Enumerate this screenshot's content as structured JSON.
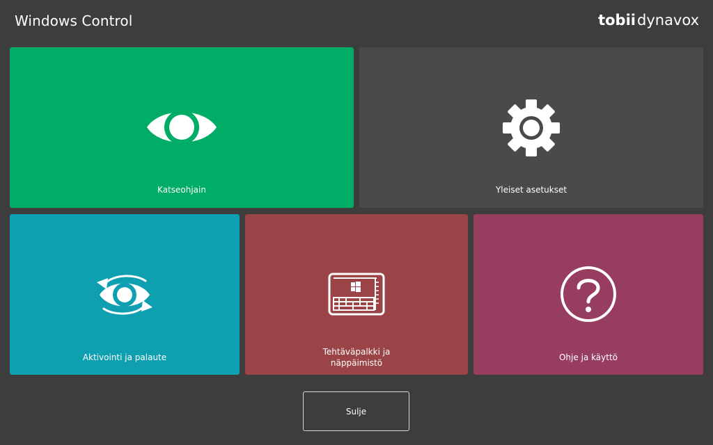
{
  "header": {
    "title": "Windows Control",
    "brand_part1": "tobii",
    "brand_part2": "dynavox"
  },
  "colors": {
    "background": "#3d3d3d",
    "gaze_tile": "#00ad66",
    "settings_tile": "#4a4a4c",
    "activation_tile": "#0e9fb0",
    "taskbar_tile": "#9b4448",
    "help_tile": "#973e60",
    "icon_foreground": "#ffffff"
  },
  "tiles": {
    "gaze": {
      "label": "Katseohjain",
      "icon": "eye-icon"
    },
    "settings": {
      "label": "Yleiset asetukset",
      "icon": "gear-icon"
    },
    "activation": {
      "label": "Aktivointi ja palaute",
      "icon": "eye-refresh-icon"
    },
    "taskbar": {
      "label_line1": "Tehtäväpalkki ja",
      "label_line2": "näppäimistö",
      "icon": "taskbar-keyboard-icon"
    },
    "help": {
      "label": "Ohje ja käyttö",
      "icon": "question-icon"
    }
  },
  "footer": {
    "close_label": "Sulje"
  }
}
